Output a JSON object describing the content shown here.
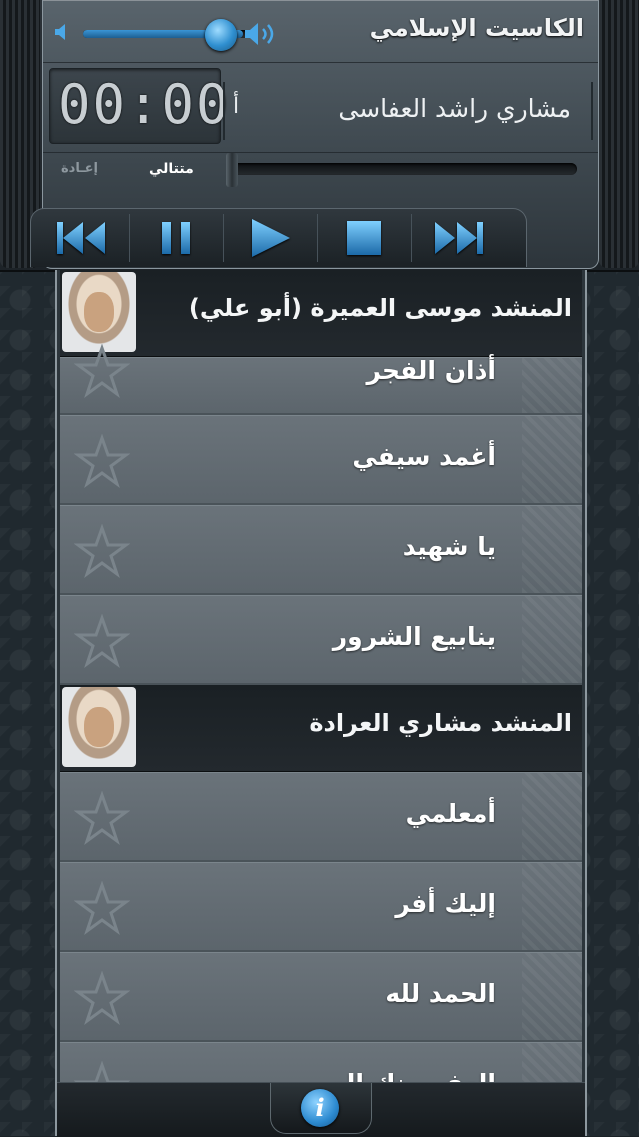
{
  "app": {
    "title": "الكاسيت الإسلامي",
    "volume_level": 0.9
  },
  "player": {
    "time": "00:00",
    "track_title": "مشاري راشد العفاسى",
    "track_scroll_text": "أ",
    "shuffle_label": "متتالي",
    "repeat_label": "إعـادة",
    "seek_position": 0.0,
    "controls": [
      "previous-icon",
      "pause-icon",
      "play-icon",
      "stop-icon",
      "next-icon"
    ]
  },
  "list": {
    "groups": [
      {
        "artist": "المنشد موسى العميرة (أبو علي)",
        "songs": [
          "أذان الفجر",
          "أغمد سيفي",
          "يا شهيد",
          "ينابيع الشرور"
        ]
      },
      {
        "artist": "المنشد مشاري العرادة",
        "songs": [
          "أمعلمي",
          "إليك أفر",
          "الحمد لله",
          "العفو منك الهى"
        ]
      }
    ]
  },
  "footer": {
    "info_label": "i"
  },
  "colors": {
    "accent": "#2f8fd0",
    "header_row": "#1d2327",
    "song_row": "#636c73"
  }
}
